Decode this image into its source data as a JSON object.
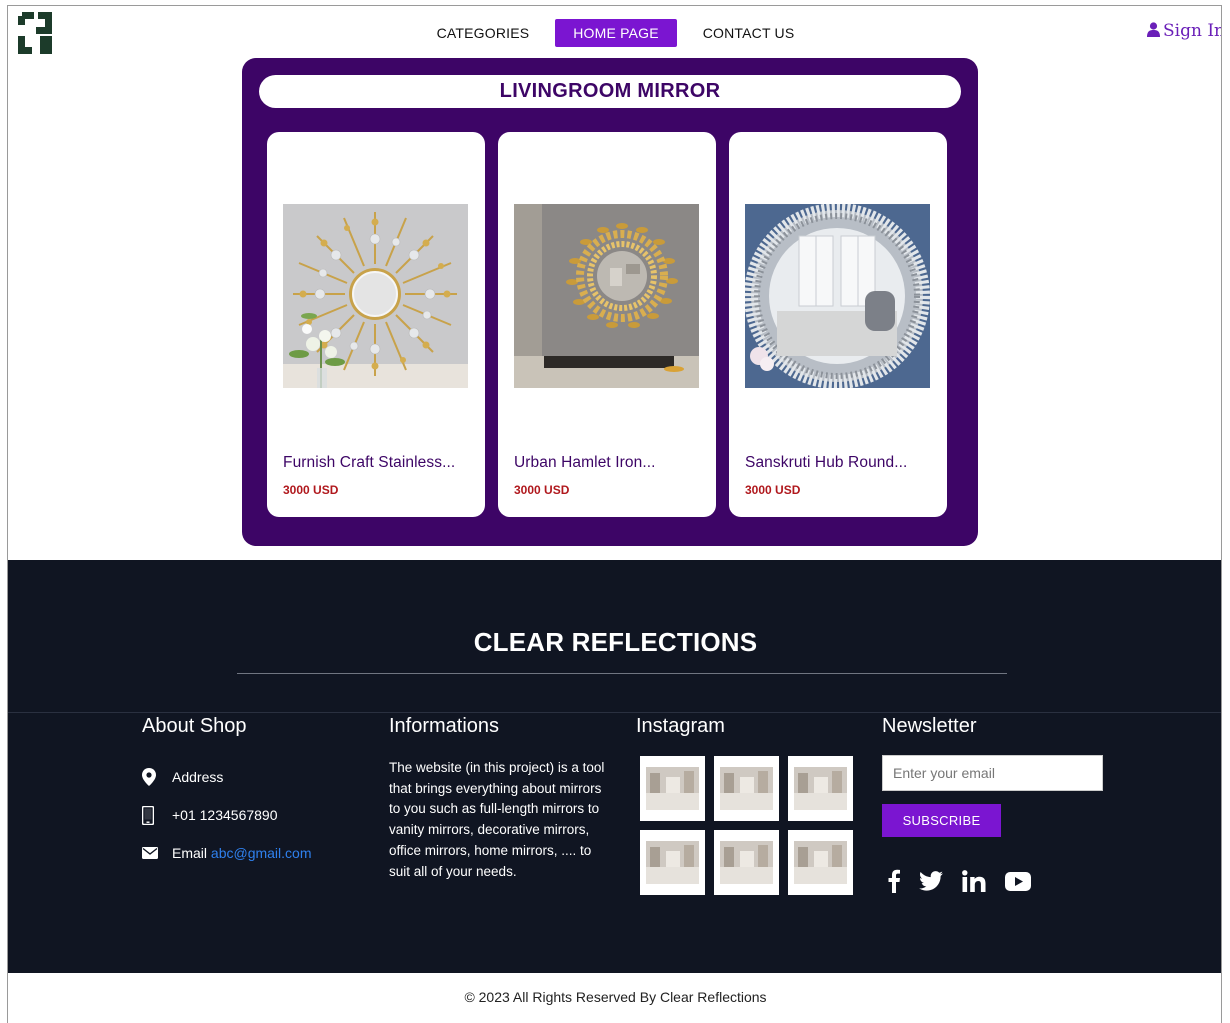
{
  "nav": {
    "categories": "CATEGORIES",
    "home": "HOME PAGE",
    "contact": "CONTACT US",
    "signin": "Sign In"
  },
  "section": {
    "title": "LIVINGROOM MIRROR",
    "products": [
      {
        "name": "Furnish Craft Stainless...",
        "price": "3000 USD"
      },
      {
        "name": "Urban Hamlet Iron...",
        "price": "3000 USD"
      },
      {
        "name": "Sanskruti Hub Round...",
        "price": "3000 USD"
      }
    ]
  },
  "footer": {
    "brand": "CLEAR REFLECTIONS",
    "about": {
      "heading": "About Shop",
      "address": "Address",
      "phone": "+01 1234567890",
      "email_label": "Email",
      "email": "abc@gmail.com"
    },
    "info": {
      "heading": "Informations",
      "text": "The website (in this project) is a tool that brings everything about mirrors to you such as full-length mirrors to vanity mirrors, decorative mirrors, office mirrors, home mirrors, .... to suit all of your needs."
    },
    "instagram": {
      "heading": "Instagram"
    },
    "newsletter": {
      "heading": "Newsletter",
      "placeholder": "Enter your email",
      "button": "SUBSCRIBE"
    },
    "social_icons": [
      "facebook-icon",
      "twitter-icon",
      "linkedin-icon",
      "youtube-icon"
    ],
    "copyright": "© 2023 All Rights Reserved By Clear Reflections"
  },
  "colors": {
    "accent": "#7b15d1",
    "panel": "#3d0566",
    "price": "#b0181d",
    "footer_bg": "#101522"
  }
}
